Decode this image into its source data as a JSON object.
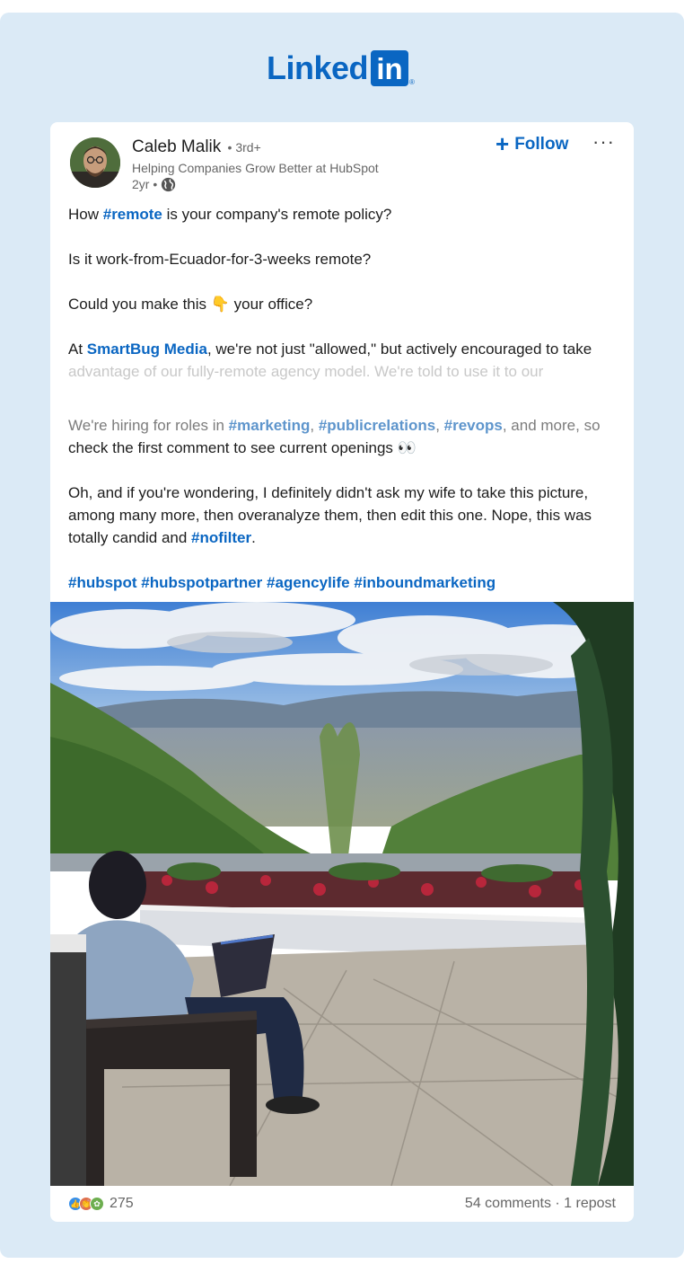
{
  "logo": {
    "text": "Linked",
    "box": "in",
    "mark": "®"
  },
  "post": {
    "author": {
      "name": "Caleb Malik",
      "degree": "• 3rd+",
      "headline": "Helping Companies Grow Better at HubSpot",
      "time": "2yr •",
      "visibility_icon": "globe-icon"
    },
    "follow_label": "Follow",
    "more_label": "···",
    "body": {
      "l1_pre": "How ",
      "l1_tag": "#remote",
      "l1_post": " is your company's remote policy?",
      "l2": "Is it work-from-Ecuador-for-3-weeks remote?",
      "l3_pre": "Could you make this ",
      "l3_emoji": "👇",
      "l3_post": " your office?",
      "l4_pre": "At ",
      "l4_mention": "SmartBug Media",
      "l4_post": ", we're not just \"allowed,\" but actively encouraged to take",
      "l5": "advantage of our fully-remote agency model. We're told to use it to our",
      "l6_pre": "We're hiring for roles in ",
      "l6_tag1": "#marketing",
      "l6_sep1": ", ",
      "l6_tag2": "#publicrelations",
      "l6_sep2": ", ",
      "l6_tag3": "#revops",
      "l6_post": ", and more, so",
      "l7": "check the first comment to see current openings 👀",
      "l8": "Oh, and if you're wondering, I definitely didn't ask my wife to take this picture,",
      "l9": "among many more, then overanalyze them, then edit this one. Nope, this was",
      "l10_pre": "totally candid and ",
      "l10_tag": "#nofilter",
      "l10_post": ".",
      "tags": [
        "#hubspot",
        "#hubspotpartner",
        "#agencylife",
        "#inboundmarketing"
      ]
    },
    "stats": {
      "reaction_count": "275",
      "engagement": "54 comments · 1 repost"
    },
    "colors": {
      "accent": "#0a66c2",
      "frame": "#dbeaf6"
    }
  }
}
